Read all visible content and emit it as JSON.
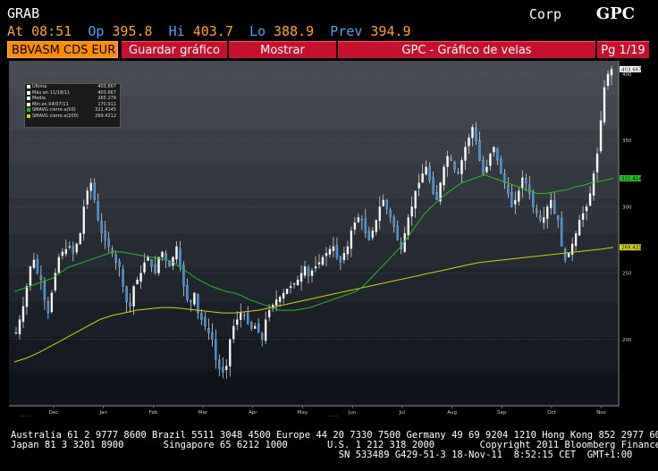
{
  "header": {
    "function": "GRAB",
    "sector": "Corp",
    "ticker": "GPC"
  },
  "quote": {
    "at_label": "At",
    "at": "08:51",
    "op_label": "Op",
    "op": "395.8",
    "hi_label": "Hi",
    "hi": "403.7",
    "lo_label": "Lo",
    "lo": "388.9",
    "prev_label": "Prev",
    "prev": "394.9"
  },
  "toolbar": {
    "source": "BBVASM CDS EUR",
    "save": "Guardar gráfico",
    "show": "Mostrar",
    "title": "GPC - Gráfico de velas",
    "page": "Pg 1/19"
  },
  "legend": [
    {
      "label": "Última",
      "value": "403.667",
      "color": "#ffffff"
    },
    {
      "label": "Máx en 11/18/11",
      "value": "403.667",
      "color": "#ffffff"
    },
    {
      "label": "Media",
      "value": "265.279",
      "color": "#ffffff"
    },
    {
      "label": "Mín en 04/07/11",
      "value": "170.911",
      "color": "#ffffff"
    },
    {
      "label": "SMAVG cierre a(50)",
      "value": "321.4145",
      "color": "#22c022"
    },
    {
      "label": "SMAVG cierre a(200)",
      "value": "269.4212",
      "color": "#d4d400"
    }
  ],
  "chart_data": {
    "type": "candlestick",
    "x_tick_labels": [
      "Dec",
      "Jan",
      "Feb",
      "Mar",
      "Apr",
      "May",
      "Jun",
      "Jul",
      "Aug",
      "Sep",
      "Oct",
      "Nov"
    ],
    "year_labels": [
      "2010",
      "2011"
    ],
    "y_tick_labels": [
      "200",
      "250",
      "300",
      "350",
      "400"
    ],
    "ylim": [
      150,
      410
    ],
    "last_price_tag": "403.667",
    "sma50_tag": "321.4145",
    "sma200_tag": "269.4212",
    "close_series_approx": [
      205,
      215,
      225,
      240,
      255,
      260,
      250,
      245,
      230,
      220,
      235,
      250,
      262,
      266,
      268,
      270,
      265,
      272,
      280,
      300,
      312,
      318,
      305,
      290,
      280,
      275,
      270,
      265,
      258,
      255,
      240,
      228,
      225,
      240,
      245,
      250,
      258,
      262,
      255,
      250,
      262,
      266,
      260,
      255,
      262,
      270,
      255,
      240,
      230,
      228,
      235,
      220,
      215,
      210,
      205,
      200,
      185,
      178,
      175,
      180,
      200,
      210,
      215,
      220,
      218,
      212,
      208,
      210,
      205,
      200,
      215,
      222,
      226,
      230,
      232,
      235,
      238,
      240,
      242,
      245,
      250,
      255,
      248,
      252,
      255,
      258,
      262,
      265,
      268,
      270,
      262,
      258,
      265,
      270,
      282,
      288,
      292,
      290,
      280,
      275,
      282,
      290,
      300,
      305,
      298,
      292,
      285,
      275,
      268,
      280,
      292,
      300,
      312,
      318,
      325,
      330,
      320,
      310,
      305,
      318,
      330,
      338,
      335,
      328,
      325,
      335,
      345,
      352,
      360,
      350,
      335,
      325,
      330,
      340,
      345,
      335,
      325,
      318,
      310,
      300,
      305,
      312,
      322,
      318,
      310,
      300,
      295,
      290,
      292,
      300,
      305,
      295,
      290,
      270,
      260,
      265,
      272,
      280,
      290,
      295,
      300,
      310,
      325,
      340,
      365,
      390,
      400,
      403.667
    ],
    "sma50_approx": [
      236,
      238,
      240,
      242,
      244,
      246,
      250,
      254,
      256,
      258,
      260,
      262,
      264,
      266,
      266,
      265,
      264,
      263,
      262,
      261,
      260,
      258,
      254,
      250,
      246,
      243,
      240,
      238,
      236,
      235,
      233,
      230,
      228,
      226,
      224,
      222,
      222,
      222,
      223,
      224,
      226,
      228,
      230,
      232,
      234,
      236,
      240,
      246,
      252,
      258,
      264,
      270,
      278,
      286,
      294,
      300,
      305,
      310,
      314,
      318,
      320,
      322,
      324,
      322,
      320,
      318,
      316,
      314,
      312,
      310,
      310,
      311,
      312,
      313,
      315,
      316,
      318,
      319,
      320,
      321.4145
    ],
    "sma200_approx": [
      183,
      186,
      190,
      195,
      200,
      205,
      210,
      215,
      218,
      220,
      222,
      223,
      224,
      224,
      223,
      222,
      221,
      220,
      220,
      221,
      222,
      224,
      226,
      228,
      230,
      232,
      234,
      236,
      238,
      240,
      242,
      244,
      246,
      248,
      250,
      252,
      254,
      256,
      258,
      259,
      260,
      261,
      262,
      263,
      264,
      265,
      266,
      267,
      268,
      269.4212
    ]
  },
  "footer": {
    "line1": "Australia 61 2 9777 8600 Brazil 5511 3048 4500 Europe 44 20 7330 7500 Germany 49 69 9204 1210 Hong Kong 852 2977 6000",
    "line2": "Japan 81 3 3201 8900       Singapore 65 6212 1000       U.S. 1 212 318 2000        Copyright 2011 Bloomberg Finance L.P.",
    "line3": "                                                          SN 533489 G429-51-3 18-Nov-11  8:52:15 CET  GMT+1:00"
  },
  "colors": {
    "amber": "#ffa028",
    "blue_value": "#4aa3ff",
    "toolbar_red": "#c8102e",
    "toolbar_orange": "#ff8c00",
    "candle": "#ffffff",
    "candle_down": "#3a8fe0",
    "sma50": "#22c022",
    "sma200": "#d4d400"
  }
}
